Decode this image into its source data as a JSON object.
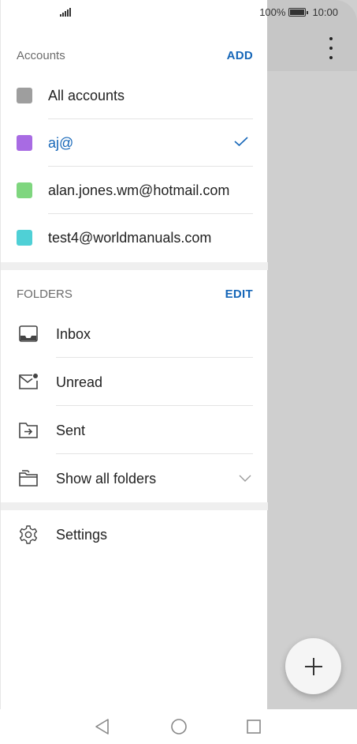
{
  "status_bar": {
    "battery_percent": "100%",
    "time": "10:00",
    "icons": [
      "signal-icon",
      "battery-icon"
    ]
  },
  "accounts": {
    "title": "Accounts",
    "action": "ADD",
    "items": [
      {
        "label": "All accounts",
        "color": "#9e9e9e",
        "selected": false
      },
      {
        "label": "aj@",
        "color": "#a86be3",
        "selected": true
      },
      {
        "label": "alan.jones.wm@hotmail.com",
        "color": "#7fd67f",
        "selected": false
      },
      {
        "label": "test4@worldmanuals.com",
        "color": "#4fd0d6",
        "selected": false
      }
    ]
  },
  "folders": {
    "title": "FOLDERS",
    "action": "EDIT",
    "items": [
      {
        "label": "Inbox",
        "icon": "inbox-icon"
      },
      {
        "label": "Unread",
        "icon": "unread-mail-icon"
      },
      {
        "label": "Sent",
        "icon": "sent-folder-icon"
      },
      {
        "label": "Show all folders",
        "icon": "folders-icon"
      }
    ]
  },
  "settings": {
    "label": "Settings",
    "icon": "gear-icon"
  },
  "colors": {
    "accent": "#1566b8",
    "app_background": "#cfcfcf"
  },
  "nav_bar": [
    "back-icon",
    "home-icon",
    "recents-icon"
  ]
}
